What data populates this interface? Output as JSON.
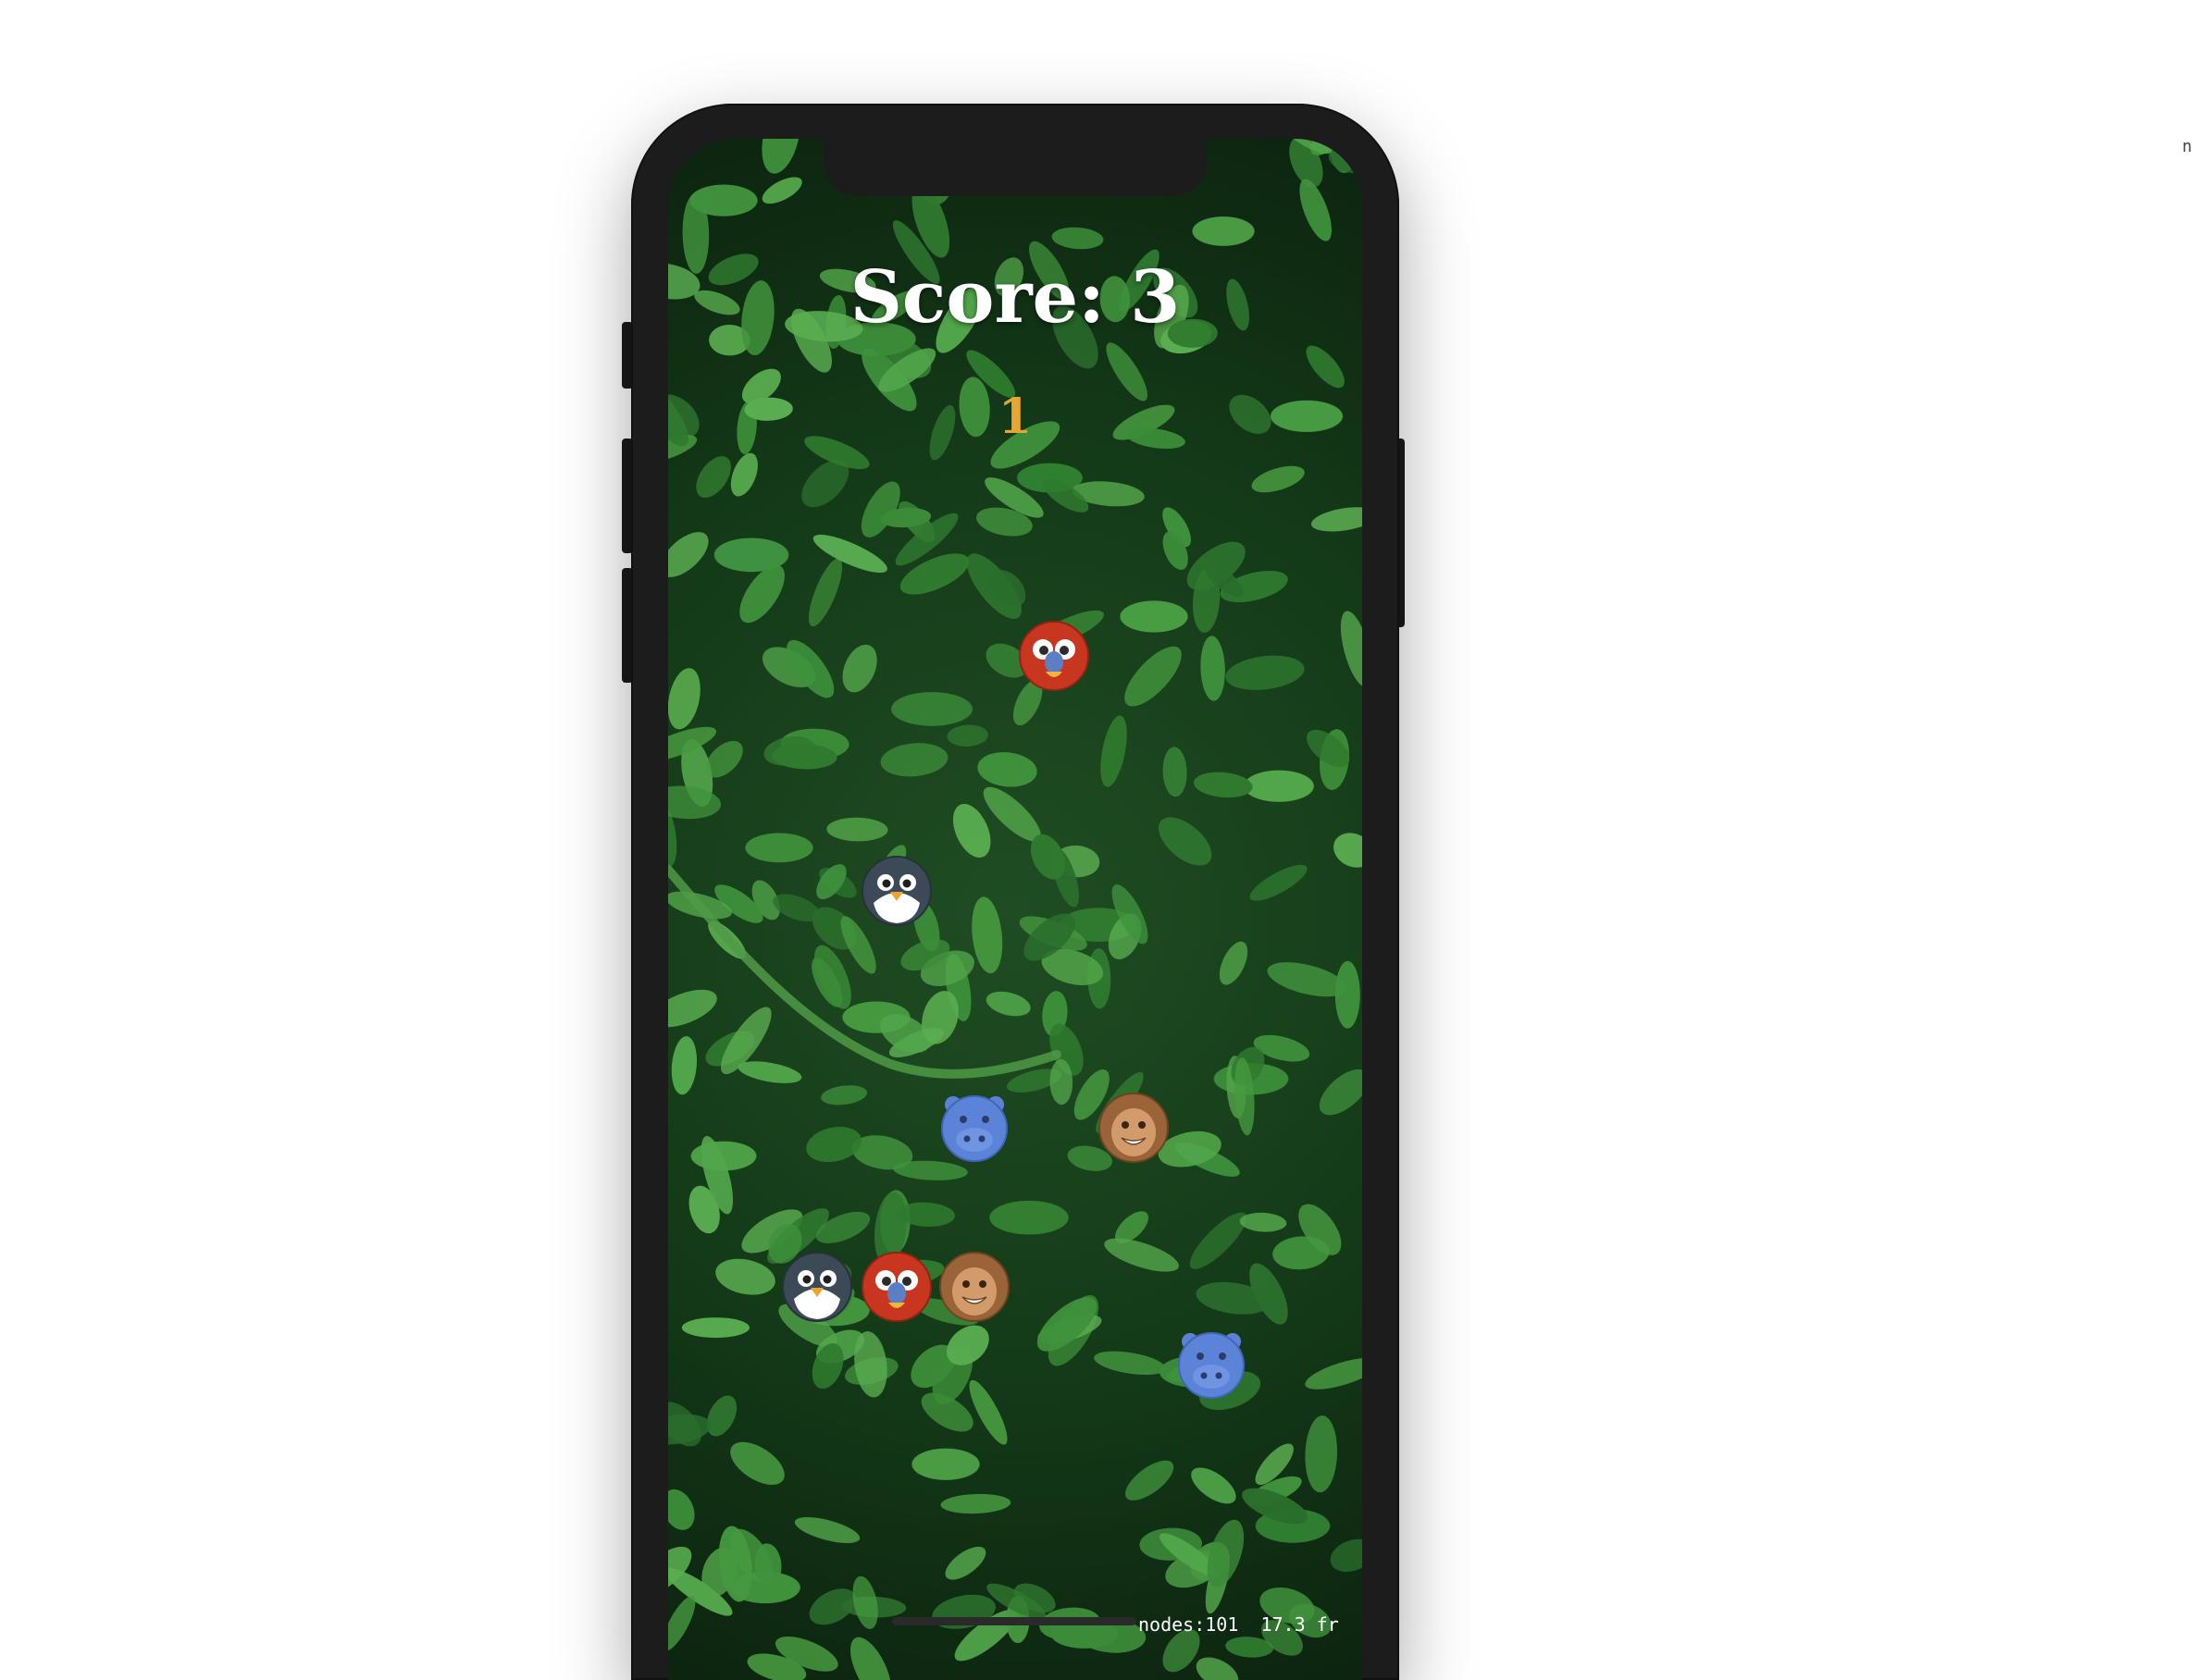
{
  "hud": {
    "score_text": "Score: 3",
    "combo_text": "1",
    "combo_color": "#e9a531"
  },
  "debug": {
    "nodes_text": "nodes:101",
    "fps_text": "17.3 fr"
  },
  "stray_text": "n",
  "colors": {
    "phone_frame": "#1c1c1c",
    "score_text": "#ffffff",
    "leaf_green": "#3e8f3b"
  },
  "critters": [
    {
      "kind": "parrot",
      "icon": "parrot-face-icon"
    },
    {
      "kind": "penguin",
      "icon": "penguin-face-icon"
    },
    {
      "kind": "hippo",
      "icon": "hippo-face-icon"
    },
    {
      "kind": "monkey",
      "icon": "monkey-face-icon"
    },
    {
      "kind": "penguin",
      "icon": "penguin-face-icon"
    },
    {
      "kind": "parrot",
      "icon": "parrot-face-icon"
    },
    {
      "kind": "monkey",
      "icon": "monkey-face-icon"
    },
    {
      "kind": "hippo",
      "icon": "hippo-face-icon"
    }
  ]
}
